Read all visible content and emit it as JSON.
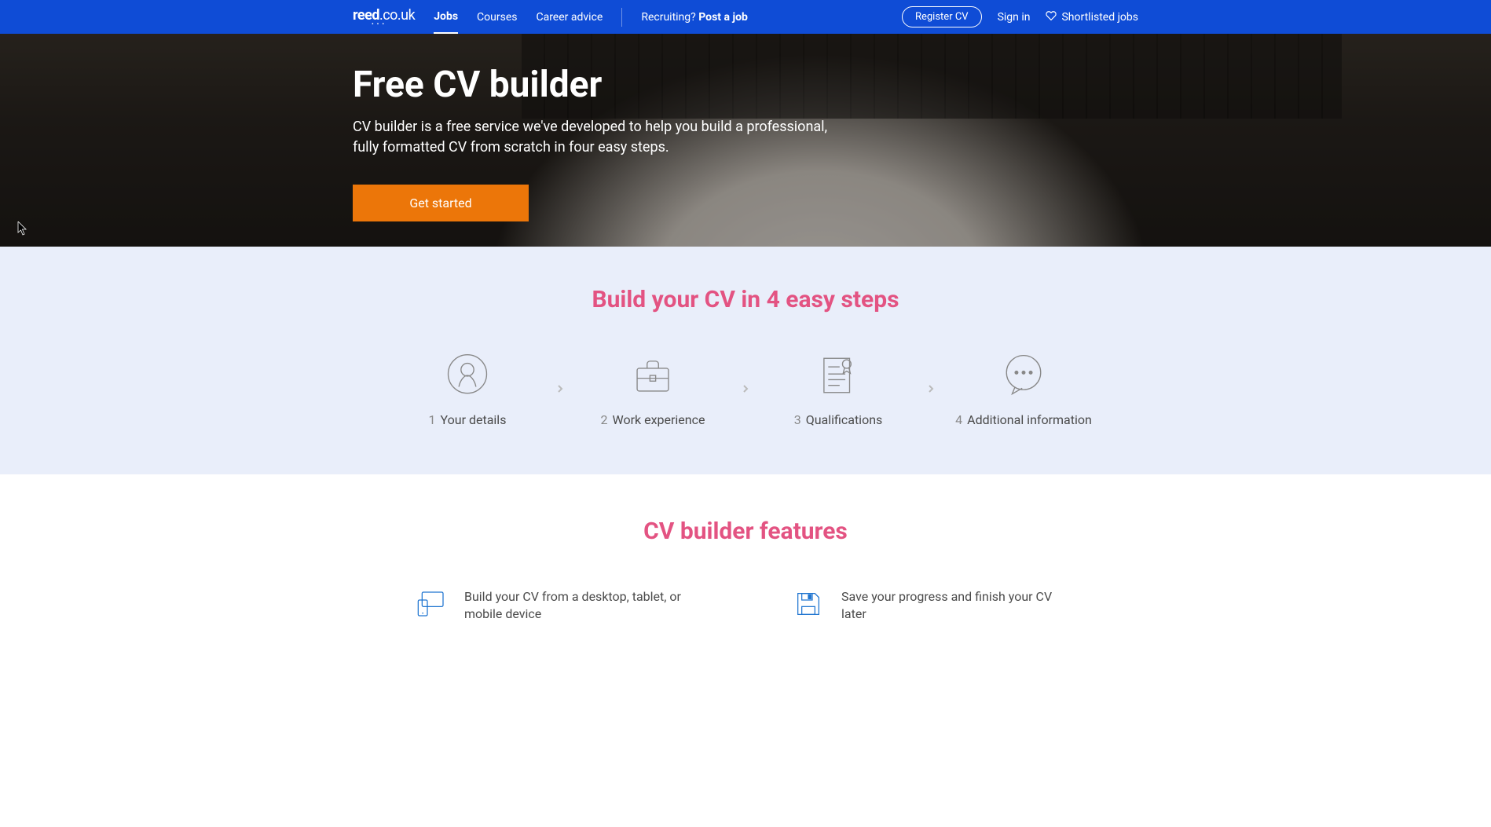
{
  "nav": {
    "logo_bold": "reed",
    "logo_suffix": ".co.uk",
    "links": [
      "Jobs",
      "Courses",
      "Career advice"
    ],
    "active_link_index": 0,
    "recruiting_prefix": "Recruiting? ",
    "recruiting_bold": "Post a job",
    "register_cv": "Register CV",
    "sign_in": "Sign in",
    "shortlisted": "Shortlisted jobs"
  },
  "hero": {
    "title": "Free CV builder",
    "subtitle": "CV builder is a free service we've developed to help you build a professional, fully formatted CV from scratch in four easy steps.",
    "cta": "Get started"
  },
  "steps": {
    "title": "Build your CV in 4 easy steps",
    "items": [
      {
        "num": "1",
        "label": "Your details"
      },
      {
        "num": "2",
        "label": "Work experience"
      },
      {
        "num": "3",
        "label": "Qualifications"
      },
      {
        "num": "4",
        "label": "Additional information"
      }
    ]
  },
  "features": {
    "title": "CV builder features",
    "items": [
      {
        "text": "Build your CV from a desktop, tablet, or mobile device"
      },
      {
        "text": "Save your progress and finish your CV later"
      }
    ]
  }
}
